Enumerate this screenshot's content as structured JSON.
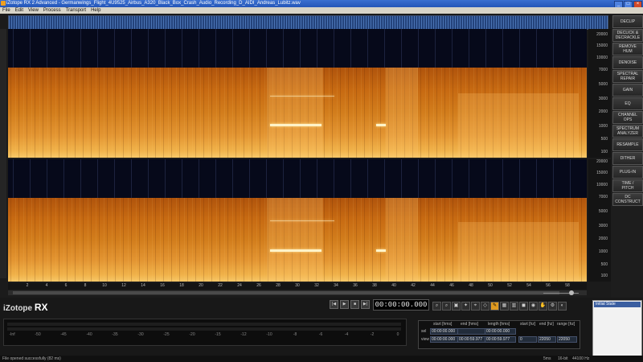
{
  "window": {
    "title": "iZotope RX 2 Advanced - Germanwings_Flight_4U9525_Airbus_A320_Black_Box_Crash_Audio_Recording_D_AIDI_Andreas_Lubitz.wav"
  },
  "menu": [
    "File",
    "Edit",
    "View",
    "Process",
    "Transport",
    "Help"
  ],
  "freq_labels": [
    "20000",
    "15000",
    "10000",
    "7000",
    "5000",
    "3000",
    "2000",
    "1000",
    "500",
    "100"
  ],
  "time_labels": [
    "2",
    "4",
    "6",
    "8",
    "10",
    "12",
    "14",
    "16",
    "18",
    "20",
    "22",
    "24",
    "26",
    "28",
    "30",
    "32",
    "34",
    "36",
    "38",
    "40",
    "42",
    "44",
    "46",
    "48",
    "50",
    "52",
    "54",
    "56",
    "58"
  ],
  "modules": [
    "DECLIP",
    "DECLICK &\nDECRACKLE",
    "REMOVE\nHUM",
    "DENOISE",
    "SPECTRAL\nREPAIR",
    "GAIN",
    "EQ",
    "CHANNEL\nOPS",
    "SPECTRUM\nANALYZER",
    "RESAMPLE",
    "DITHER",
    "PLUG-IN",
    "TIME /\nPITCH",
    "DC\nCONSTRUCT"
  ],
  "transport": {
    "buttons": [
      "|◀",
      "▶",
      "■",
      "▶|"
    ],
    "timecode": "00:00:00.000"
  },
  "tools": [
    "⌕",
    "⌕",
    "▣",
    "✦",
    "⌖",
    "◇",
    "✎",
    "▦",
    "▥",
    "◼",
    "◉",
    "✋",
    "⚙",
    "◐"
  ],
  "logo": {
    "brand": "iZotope",
    "product": "RX",
    "edition": "advanced"
  },
  "meter_scale": [
    "-Inf",
    "-50",
    "-45",
    "-40",
    "-35",
    "-30",
    "-25",
    "-20",
    "-15",
    "-12",
    "-10",
    "-8",
    "-6",
    "-4",
    "-2",
    "0"
  ],
  "selection": {
    "headers": [
      "start [hms]",
      "end [hms]",
      "length [hms]",
      "start [hz]",
      "end [hz]",
      "range [hz]"
    ],
    "rows": [
      {
        "label": "sel",
        "values": [
          "00:00:00.000",
          "",
          "00:00:00.000",
          "",
          "",
          ""
        ]
      },
      {
        "label": "view",
        "values": [
          "00:00:00.000",
          "00:00:59.977",
          "00:00:59.977",
          "0",
          "22050",
          "22050"
        ]
      }
    ]
  },
  "history": {
    "items": [
      "Initial State"
    ]
  },
  "status": {
    "message": "File opened successfully (82 ms)",
    "buffer": "5ms",
    "bitdepth": "16-bit",
    "rate": "44100 Hz"
  }
}
